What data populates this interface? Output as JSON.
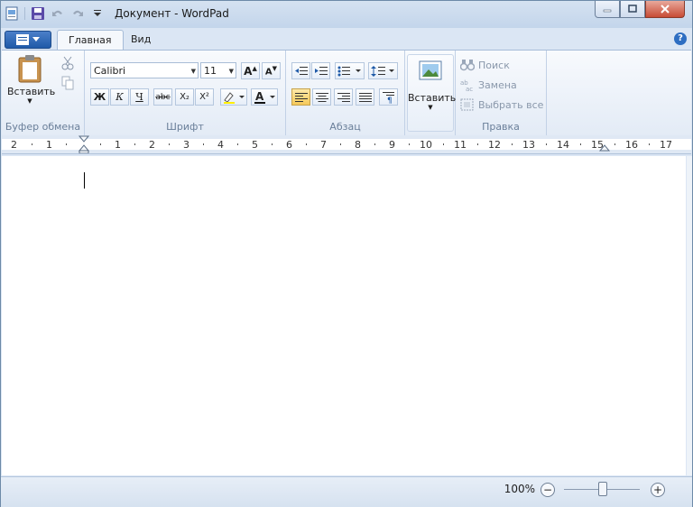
{
  "window": {
    "title": "Документ - WordPad"
  },
  "tabs": {
    "home": "Главная",
    "view": "Вид"
  },
  "clipboard": {
    "paste_label": "Вставить",
    "group_label": "Буфер обмена"
  },
  "font": {
    "family": "Calibri",
    "size": "11",
    "bold": "Ж",
    "italic": "К",
    "underline": "Ч",
    "strike": "abc",
    "subscript": "X₂",
    "superscript": "X²",
    "group_label": "Шрифт"
  },
  "paragraph": {
    "group_label": "Абзац"
  },
  "insert": {
    "label": "Вставить"
  },
  "editing": {
    "find": "Поиск",
    "replace": "Замена",
    "select_all": "Выбрать все",
    "group_label": "Правка"
  },
  "ruler": {
    "labels": [
      "2",
      "1",
      "1",
      "2",
      "3",
      "4",
      "5",
      "6",
      "7",
      "8",
      "9",
      "10",
      "11",
      "12",
      "13",
      "14",
      "15",
      "16",
      "17"
    ]
  },
  "status": {
    "zoom": "100%"
  }
}
